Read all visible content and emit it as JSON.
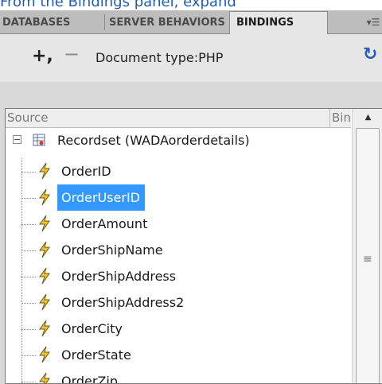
{
  "caption": "From the Bindings panel, expand",
  "tabs": [
    {
      "label": "DATABASES",
      "active": false
    },
    {
      "label": "SERVER BEHAVIORS",
      "active": false
    },
    {
      "label": "BINDINGS",
      "active": true
    }
  ],
  "toolbar": {
    "add_label": "+,",
    "remove_label": "−",
    "doctype_label": "Document type:PHP",
    "refresh_label": "C"
  },
  "tree": {
    "header": {
      "source": "Source",
      "binding": "Binding"
    },
    "recordset": {
      "label": "Recordset (WADAorderdetails)",
      "expanded": true
    },
    "fields": [
      {
        "label": "OrderID",
        "selected": false
      },
      {
        "label": "OrderUserID",
        "selected": true
      },
      {
        "label": "OrderAmount",
        "selected": false
      },
      {
        "label": "OrderShipName",
        "selected": false
      },
      {
        "label": "OrderShipAddress",
        "selected": false
      },
      {
        "label": "OrderShipAddress2",
        "selected": false
      },
      {
        "label": "OrderCity",
        "selected": false
      },
      {
        "label": "OrderState",
        "selected": false
      },
      {
        "label": "OrderZip",
        "selected": false
      }
    ]
  },
  "icons": {
    "expander": "collapse-minus-icon",
    "recordset": "recordset-icon",
    "field": "lightning-bolt-icon",
    "panel_menu": "panel-options-icon",
    "refresh": "refresh-icon"
  },
  "colors": {
    "selection": "#3399ff",
    "caption": "#1f5fb3",
    "bolt": "#f2c230"
  }
}
